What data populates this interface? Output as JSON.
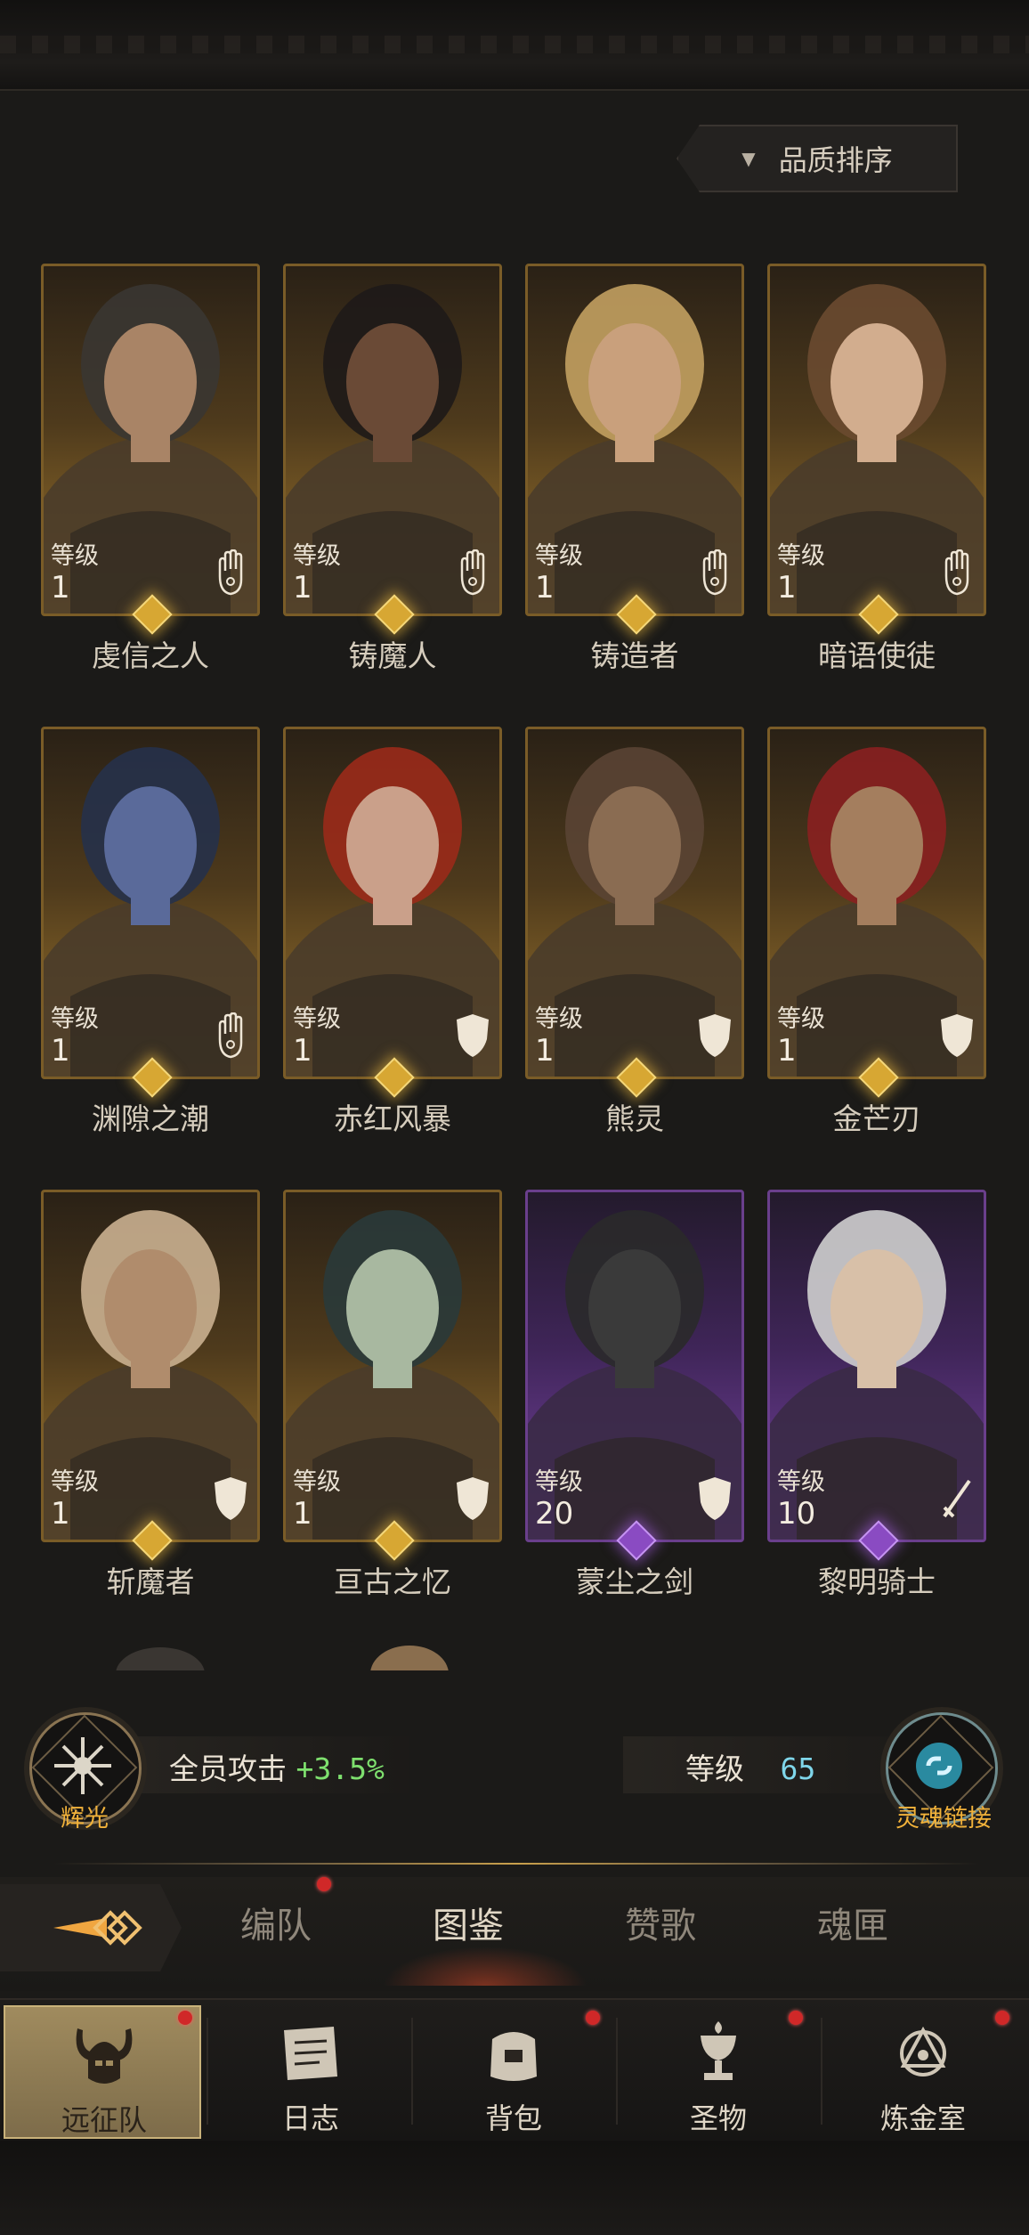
{
  "sort": {
    "label": "品质排序"
  },
  "level_label": "等级",
  "heroes": [
    {
      "name": "虔信之人",
      "level": "1",
      "class_icon": "hand-icon",
      "rarity": "gold"
    },
    {
      "name": "铸魔人",
      "level": "1",
      "class_icon": "hand-icon",
      "rarity": "gold"
    },
    {
      "name": "铸造者",
      "level": "1",
      "class_icon": "hand-icon",
      "rarity": "gold"
    },
    {
      "name": "暗语使徒",
      "level": "1",
      "class_icon": "hand-icon",
      "rarity": "gold"
    },
    {
      "name": "渊隙之潮",
      "level": "1",
      "class_icon": "hand-icon",
      "rarity": "gold"
    },
    {
      "name": "赤红风暴",
      "level": "1",
      "class_icon": "shield-icon",
      "rarity": "gold"
    },
    {
      "name": "熊灵",
      "level": "1",
      "class_icon": "shield-icon",
      "rarity": "gold"
    },
    {
      "name": "金芒刃",
      "level": "1",
      "class_icon": "shield-icon",
      "rarity": "gold"
    },
    {
      "name": "斩魔者",
      "level": "1",
      "class_icon": "shield-icon",
      "rarity": "gold"
    },
    {
      "name": "亘古之忆",
      "level": "1",
      "class_icon": "shield-icon",
      "rarity": "gold"
    },
    {
      "name": "蒙尘之剑",
      "level": "20",
      "class_icon": "shield-icon",
      "rarity": "purple"
    },
    {
      "name": "黎明骑士",
      "level": "10",
      "class_icon": "sword-icon",
      "rarity": "purple"
    }
  ],
  "stats": {
    "left_medal_label": "辉光",
    "attack_label": "全员攻击",
    "attack_value": "+3.5%",
    "level_label": "等级",
    "level_value": "65",
    "right_medal_label": "灵魂链接"
  },
  "tabs": [
    {
      "label": "编队",
      "badge": true
    },
    {
      "label": "图鉴",
      "badge": false,
      "active": true
    },
    {
      "label": "赞歌",
      "badge": false
    },
    {
      "label": "魂匣",
      "badge": false
    }
  ],
  "nav": [
    {
      "label": "远征队",
      "icon": "horned-helmet-icon",
      "active": true,
      "badge": true
    },
    {
      "label": "日志",
      "icon": "scroll-icon",
      "badge": true
    },
    {
      "label": "背包",
      "icon": "bag-icon",
      "badge": true
    },
    {
      "label": "圣物",
      "icon": "chalice-icon",
      "badge": true
    },
    {
      "label": "炼金室",
      "icon": "alchemy-icon",
      "badge": false
    }
  ],
  "colors": {
    "gold_frame": "#a37a2e",
    "purple_frame": "#7b45a8",
    "attack_value": "#7ee06e",
    "level_value": "#7fd6ea",
    "medal_label": "#f2b23a",
    "badge": "#d02828"
  }
}
